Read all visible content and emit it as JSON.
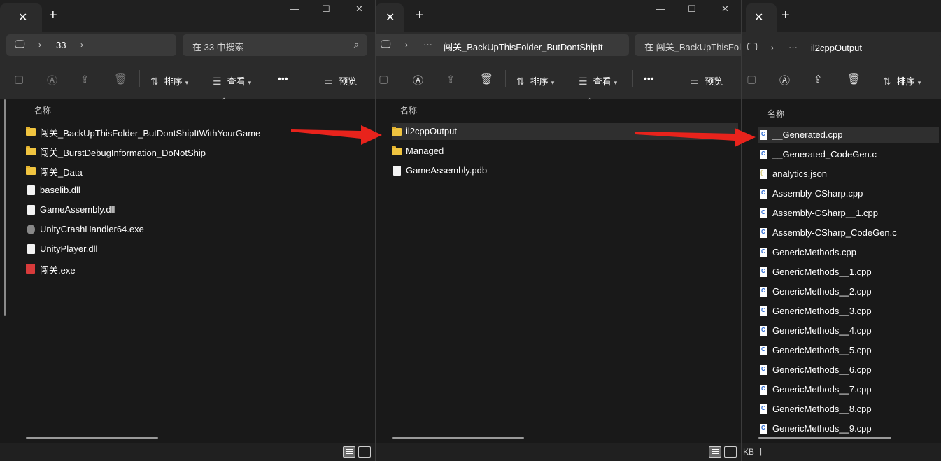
{
  "window1": {
    "address": {
      "segment": "33"
    },
    "search_placeholder": "在 33 中搜索",
    "toolbar": {
      "sort": "排序",
      "view": "查看",
      "more": "•••",
      "preview": "预览"
    },
    "column_name": "名称",
    "items": [
      {
        "name": "闯关_BackUpThisFolder_ButDontShipItWithYourGame",
        "icon": "folder-icon"
      },
      {
        "name": "闯关_BurstDebugInformation_DoNotShip",
        "icon": "folder-icon"
      },
      {
        "name": "闯关_Data",
        "icon": "folder-icon"
      },
      {
        "name": "baselib.dll",
        "icon": "file-icon"
      },
      {
        "name": "GameAssembly.dll",
        "icon": "file-icon"
      },
      {
        "name": "UnityCrashHandler64.exe",
        "icon": "crash-handler-icon"
      },
      {
        "name": "UnityPlayer.dll",
        "icon": "file-icon"
      },
      {
        "name": "闯关.exe",
        "icon": "game-exe-icon"
      }
    ]
  },
  "window2": {
    "address": {
      "ellipsis": "···",
      "segment": "闯关_BackUpThisFolder_ButDontShipIt"
    },
    "search_placeholder": "在 闯关_BackUpThisFolder_ButDontShipItWithYourGame 中搜索",
    "toolbar": {
      "sort": "排序",
      "view": "查看",
      "more": "•••",
      "preview": "预览"
    },
    "column_name": "名称",
    "items": [
      {
        "name": "il2cppOutput",
        "icon": "folder-icon"
      },
      {
        "name": "Managed",
        "icon": "folder-icon"
      },
      {
        "name": "GameAssembly.pdb",
        "icon": "pdb-file-icon"
      }
    ]
  },
  "window3": {
    "address": {
      "ellipsis": "···",
      "segment": "il2cppOutput"
    },
    "toolbar": {
      "sort": "排序"
    },
    "column_name": "名称",
    "status_text": "KB",
    "items": [
      {
        "name": "__Generated.cpp",
        "icon": "cpp-file-icon"
      },
      {
        "name": "__Generated_CodeGen.c",
        "icon": "cpp-file-icon"
      },
      {
        "name": "analytics.json",
        "icon": "json-file-icon"
      },
      {
        "name": "Assembly-CSharp.cpp",
        "icon": "cpp-file-icon"
      },
      {
        "name": "Assembly-CSharp__1.cpp",
        "icon": "cpp-file-icon"
      },
      {
        "name": "Assembly-CSharp_CodeGen.c",
        "icon": "cpp-file-icon"
      },
      {
        "name": "GenericMethods.cpp",
        "icon": "cpp-file-icon"
      },
      {
        "name": "GenericMethods__1.cpp",
        "icon": "cpp-file-icon"
      },
      {
        "name": "GenericMethods__2.cpp",
        "icon": "cpp-file-icon"
      },
      {
        "name": "GenericMethods__3.cpp",
        "icon": "cpp-file-icon"
      },
      {
        "name": "GenericMethods__4.cpp",
        "icon": "cpp-file-icon"
      },
      {
        "name": "GenericMethods__5.cpp",
        "icon": "cpp-file-icon"
      },
      {
        "name": "GenericMethods__6.cpp",
        "icon": "cpp-file-icon"
      },
      {
        "name": "GenericMethods__7.cpp",
        "icon": "cpp-file-icon"
      },
      {
        "name": "GenericMethods__8.cpp",
        "icon": "cpp-file-icon"
      },
      {
        "name": "GenericMethods__9.cpp",
        "icon": "cpp-file-icon"
      }
    ]
  },
  "colors": {
    "annotation_arrow": "#e8231c",
    "folder": "#f0c440",
    "background": "#191919"
  }
}
